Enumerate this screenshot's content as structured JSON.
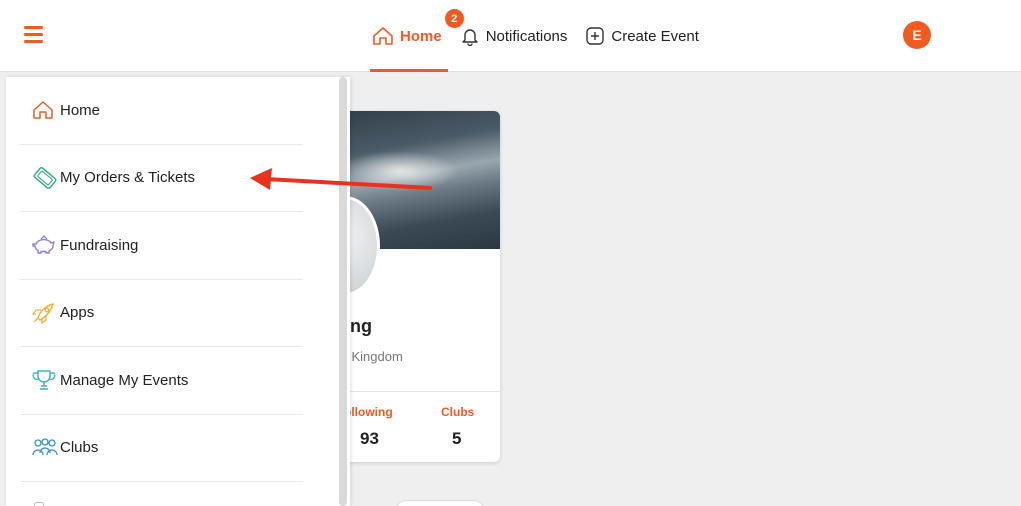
{
  "header": {
    "nav": [
      {
        "label": "Home",
        "icon": "home-icon",
        "active": true
      },
      {
        "label": "Notifications",
        "icon": "bell-icon",
        "active": false
      },
      {
        "label": "Create Event",
        "icon": "plus-square-icon",
        "active": false
      }
    ],
    "notification_count": "2",
    "avatar_letter": "E"
  },
  "sidebar": {
    "items": [
      {
        "label": "Home",
        "icon": "home-icon"
      },
      {
        "label": "My Orders & Tickets",
        "icon": "ticket-icon"
      },
      {
        "label": "Fundraising",
        "icon": "piggy-bank-icon"
      },
      {
        "label": "Apps",
        "icon": "rocket-icon"
      },
      {
        "label": "Manage My Events",
        "icon": "trophy-icon"
      },
      {
        "label": "Clubs",
        "icon": "users-icon"
      }
    ]
  },
  "profile_card": {
    "name_fragment": "ing",
    "location_fragment": "l Kingdom",
    "stats": [
      {
        "label": "ollowing",
        "value": "93"
      },
      {
        "label": "Clubs",
        "value": "5"
      }
    ]
  },
  "colors": {
    "accent": "#f25a22",
    "home_icon": "#f25a22",
    "ticket_icon": "#3cae8e",
    "piggy_icon": "#8e7be0",
    "rocket_icon": "#f2b23c",
    "trophy_icon": "#3fb3c8",
    "clubs_icon": "#3a8fd6",
    "annotation_arrow": "#e8321e"
  }
}
